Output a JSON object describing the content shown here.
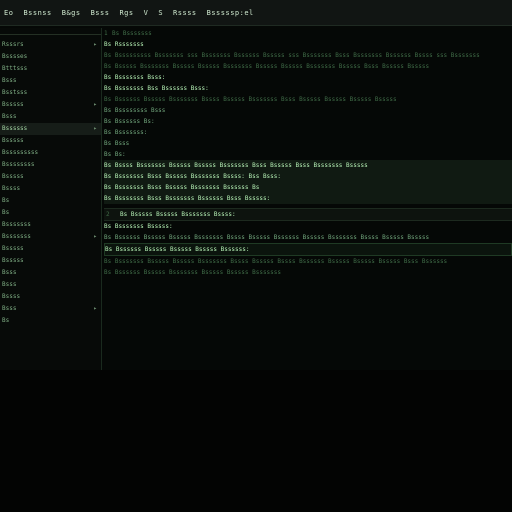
{
  "menu": [
    "Eo",
    "Bssnss",
    "B&gs",
    "Bsss",
    "Rgs",
    "V",
    "S",
    "Rssss",
    "Bsssssp:el"
  ],
  "sidebar": {
    "items": [
      {
        "label": "Rsssrs",
        "expandable": true
      },
      {
        "label": "Bsssses",
        "expandable": false
      },
      {
        "label": "Btttsss",
        "expandable": false
      },
      {
        "label": "Bsss",
        "expandable": false
      },
      {
        "label": "Bsstsss",
        "expandable": false
      },
      {
        "label": "Bsssss",
        "expandable": true
      },
      {
        "label": "Bsss",
        "expandable": false
      },
      {
        "label": "Bssssss",
        "expandable": true
      },
      {
        "label": "Bsssss",
        "expandable": false
      },
      {
        "label": "Bsssssssss",
        "expandable": false
      },
      {
        "label": "Bssssssss",
        "expandable": false
      },
      {
        "label": "Bsssss",
        "expandable": false
      },
      {
        "label": "Bssss",
        "expandable": false
      },
      {
        "label": "Bs",
        "expandable": false
      },
      {
        "label": "Bs",
        "expandable": false
      },
      {
        "label": "Bsssssss",
        "expandable": false
      },
      {
        "label": "Bsssssss",
        "expandable": true
      },
      {
        "label": "Bsssss",
        "expandable": false
      },
      {
        "label": "Bsssss",
        "expandable": false
      },
      {
        "label": "Bsss",
        "expandable": false
      },
      {
        "label": "Bsss",
        "expandable": false
      },
      {
        "label": "Bssss",
        "expandable": false
      },
      {
        "label": "Bsss",
        "expandable": true
      },
      {
        "label": "Bs",
        "expandable": false
      }
    ]
  },
  "editor": {
    "header": "Bs Bsssssss",
    "lines": [
      "Bs Rsssssss",
      "Bs  Bsssssssss Bsssssss sss Bsssssss Bssssss Bsssss sss Bsssssss Bsss Bsssssss Bssssss Bssss sss Bsssssss",
      "Bs  Bsssss Bsssssss Bsssss Bsssss Bsssssss Bsssss Bsssss Bsssssss Bsssss Bsss Bsssss Bsssss",
      "Bs Bsssssss Bsss:",
      "Bs  Bsssssss Bss Bssssss Bsss:",
      "Bs  Bssssss Bsssss Bsssssss Bssss Bsssss Bsssssss Bsss Bsssss Bsssss Bsssss Bsssss",
      "Bs  Bssssssss Bsss",
      "Bs  Bssssss Bs:",
      "Bs  Bsssssss:",
      "Bs  Bsss",
      "Bs  Bs:",
      "Bs  Bssss Bsssssss Bsssss Bsssss Bsssssss Bsss Bsssss Bsss Bsssssss Bsssss",
      "Bs  Bsssssss Bsss Bsssss Bsssssss Bssss: Bss Bsss:",
      "Bs  Bsssssss Bsss Bsssss Bsssssss Bssssss Bs",
      "Bs  Bsssssss Bsss Bsssssss Bssssss Bsss Bsssss:"
    ],
    "section_title": "Bs  Bsssss Bsssss Bsssssss Bssss:",
    "section_lines": [
      "Bs  Bsssssss Bsssss:",
      "Bs  Bssssss Bsssss Bsssss Bsssssss Bssss Bsssss Bssssss Bsssss Bsssssss Bssss Bsssss Bsssss",
      "Bs  Bssssss Bsssss Bsssss Bsssss Bssssss:"
    ],
    "footer_lines": [
      "Bs  Bsssssss Bsssss Bsssss Bsssssss Bssss Bsssss Bssss Bssssss Bsssss Bsssss Bsssss Bsss Bssssss",
      "Bs  Bssssss Bsssss Bsssssss Bsssss Bsssss Bsssssss"
    ]
  }
}
